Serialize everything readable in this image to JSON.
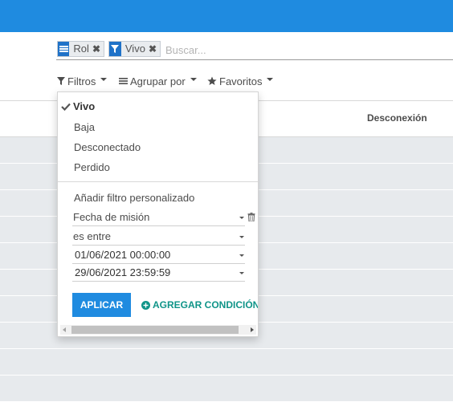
{
  "search": {
    "facets": [
      {
        "icon": "list-icon",
        "label": "Rol",
        "remove_icon": "close-icon"
      },
      {
        "icon": "filter-icon",
        "label": "Vivo",
        "remove_icon": "close-icon"
      }
    ],
    "placeholder": "Buscar..."
  },
  "toolbar": {
    "filters_label": "Filtros",
    "groupby_label": "Agrupar por",
    "favorites_label": "Favoritos"
  },
  "table": {
    "columns": [
      "Desconexión"
    ],
    "row_count": 10
  },
  "filters_menu": {
    "options": [
      {
        "label": "Vivo",
        "checked": true
      },
      {
        "label": "Baja",
        "checked": false
      },
      {
        "label": "Desconectado",
        "checked": false
      },
      {
        "label": "Perdido",
        "checked": false
      }
    ],
    "custom_filter_label": "Añadir filtro personalizado",
    "custom_condition": {
      "field": "Fecha de misión",
      "operator": "es entre",
      "value_start": "01/06/2021 00:00:00",
      "value_end": "29/06/2021 23:59:59"
    },
    "apply_label": "APLICAR",
    "add_condition_label": "AGREGAR CONDICIÓN"
  },
  "colors": {
    "topbar": "#1f8be0",
    "facet_icon_bg": "#1f72c8",
    "add_condition": "#0f9488",
    "row_bg": "#e7eaed"
  }
}
